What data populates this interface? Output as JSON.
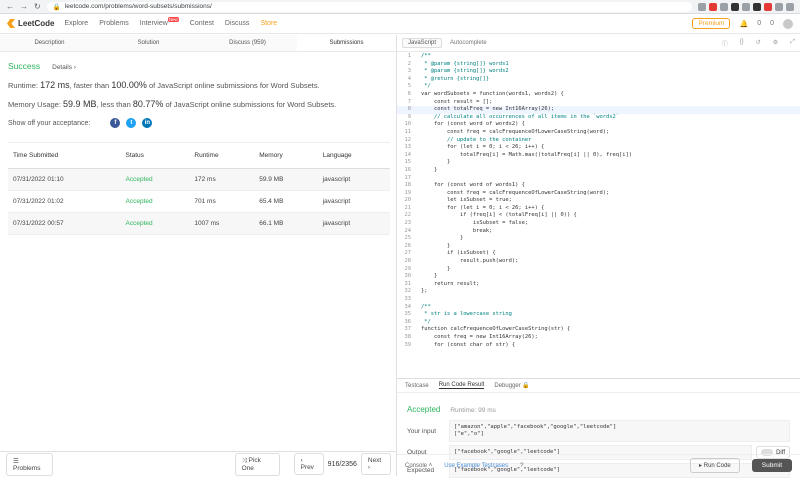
{
  "browser": {
    "url": "leetcode.com/problems/word-subsets/submissions/"
  },
  "nav": {
    "brand": "LeetCode",
    "links": [
      "Explore",
      "Problems",
      "Interview",
      "Contest",
      "Discuss",
      "Store"
    ],
    "new_badge": "New",
    "premium": "Premium",
    "notifications": "0",
    "points": "0"
  },
  "left": {
    "tabs": [
      "Description",
      "Solution",
      "Discuss (959)",
      "Submissions"
    ],
    "status": "Success",
    "details": "Details ›",
    "runtime_label": "Runtime:",
    "runtime_value": "172 ms",
    "runtime_mid": ", faster than",
    "runtime_pct": "100.00%",
    "runtime_tail": "of JavaScript online submissions for Word Subsets.",
    "memory_label": "Memory Usage:",
    "memory_value": "59.9 MB",
    "memory_mid": ", less than",
    "memory_pct": "80.77%",
    "memory_tail": "of JavaScript online submissions for Word Subsets.",
    "share_label": "Show off your acceptance:",
    "table": {
      "headers": [
        "Time Submitted",
        "Status",
        "Runtime",
        "Memory",
        "Language"
      ],
      "rows": [
        [
          "07/31/2022 01:10",
          "Accepted",
          "172 ms",
          "59.9 MB",
          "javascript"
        ],
        [
          "07/31/2022 01:02",
          "Accepted",
          "701 ms",
          "65.4 MB",
          "javascript"
        ],
        [
          "07/31/2022 00:57",
          "Accepted",
          "1007 ms",
          "66.1 MB",
          "javascript"
        ]
      ]
    },
    "footer": {
      "problems": "Problems",
      "pick_one": "Pick One",
      "prev": "Prev",
      "page": "916/2356",
      "next": "Next"
    }
  },
  "editor": {
    "language": "JavaScript",
    "autocomplete": "Autocomplete",
    "lines": [
      "/**",
      " * @param {string[]} words1",
      " * @param {string[]} words2",
      " * @return {string[]}",
      " */",
      "var wordSubsets = function(words1, words2) {",
      "    const result = [];",
      "    const totalFreq = new Int16Array(26);",
      "    // calculate all occurrences of all items in the `words2`",
      "    for (const word of words2) {",
      "        const freq = calcFrequenceOfLowerCaseString(word);",
      "        // update to the container",
      "        for (let i = 0; i < 26; i++) {",
      "            totalFreq[i] = Math.max((totalFreq[i] || 0), freq[i])",
      "        }",
      "    }",
      "",
      "    for (const word of words1) {",
      "        const freq = calcFrequenceOfLowerCaseString(word);",
      "        let isSubset = true;",
      "        for (let i = 0; i < 26; i++) {",
      "            if (freq[i] < (totalFreq[i] || 0)) {",
      "                isSubset = false;",
      "                break;",
      "            }",
      "        }",
      "        if (isSubset) {",
      "            result.push(word);",
      "        }",
      "    }",
      "    return result;",
      "};",
      "",
      "/**",
      " * str is a lowercase string",
      " */",
      "function calcFrequenceOfLowerCaseString(str) {",
      "    const freq = new Int16Array(26);",
      "    for (const char of str) {"
    ]
  },
  "console": {
    "tabs": [
      "Testcase",
      "Run Code Result",
      "Debugger"
    ],
    "status": "Accepted",
    "runtime": "Runtime: 99 ms",
    "input_label": "Your input",
    "input_lines": [
      "[\"amazon\",\"apple\",\"facebook\",\"google\",\"leetcode\"]",
      "[\"e\",\"o\"]"
    ],
    "output_label": "Output",
    "output": "[\"facebook\",\"google\",\"leetcode\"]",
    "diff": "Diff",
    "expected_label": "Expected",
    "expected": "[\"facebook\",\"google\",\"leetcode\"]",
    "footer": {
      "console": "Console",
      "example": "Use Example Testcases",
      "run": "Run Code",
      "submit": "Submit"
    }
  }
}
